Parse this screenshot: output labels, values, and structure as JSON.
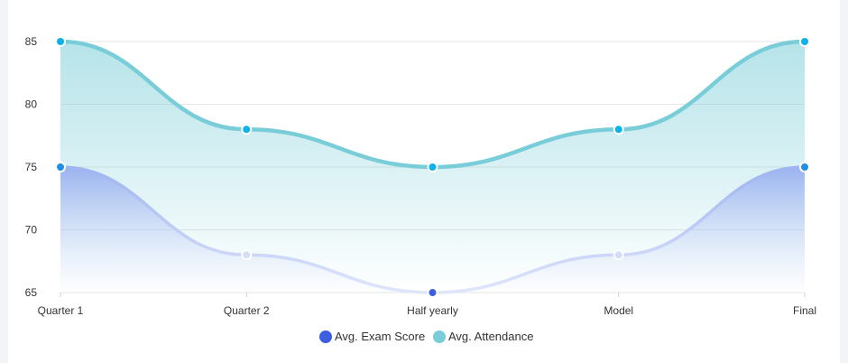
{
  "chart_data": {
    "type": "area",
    "categories": [
      "Quarter 1",
      "Quarter 2",
      "Half yearly",
      "Model",
      "Final"
    ],
    "series": [
      {
        "name": "Avg. Exam Score",
        "values": [
          75,
          68,
          65,
          68,
          75
        ],
        "color": "#3d5ede"
      },
      {
        "name": "Avg. Attendance",
        "values": [
          85,
          78,
          75,
          78,
          85
        ],
        "color": "#79cdd8"
      }
    ],
    "y_ticks": [
      "85",
      "80",
      "75",
      "70",
      "65"
    ],
    "ylim": [
      65,
      85
    ],
    "grid": "horizontal",
    "legend_position": "bottom-center",
    "curve": "smooth",
    "marker_color": "#0db2ea"
  }
}
